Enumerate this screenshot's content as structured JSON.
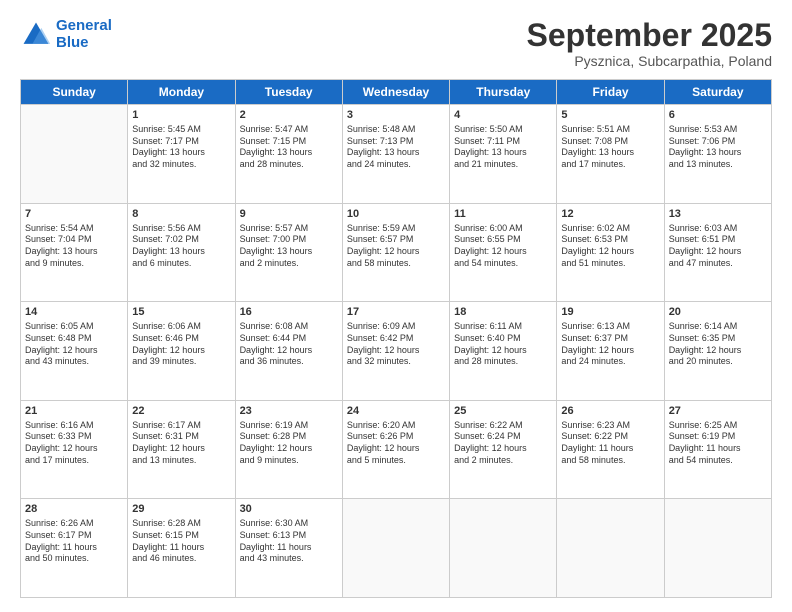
{
  "logo": {
    "line1": "General",
    "line2": "Blue"
  },
  "header": {
    "month": "September 2025",
    "location": "Pysznica, Subcarpathia, Poland"
  },
  "weekdays": [
    "Sunday",
    "Monday",
    "Tuesday",
    "Wednesday",
    "Thursday",
    "Friday",
    "Saturday"
  ],
  "weeks": [
    [
      {
        "day": "",
        "info": ""
      },
      {
        "day": "1",
        "info": "Sunrise: 5:45 AM\nSunset: 7:17 PM\nDaylight: 13 hours\nand 32 minutes."
      },
      {
        "day": "2",
        "info": "Sunrise: 5:47 AM\nSunset: 7:15 PM\nDaylight: 13 hours\nand 28 minutes."
      },
      {
        "day": "3",
        "info": "Sunrise: 5:48 AM\nSunset: 7:13 PM\nDaylight: 13 hours\nand 24 minutes."
      },
      {
        "day": "4",
        "info": "Sunrise: 5:50 AM\nSunset: 7:11 PM\nDaylight: 13 hours\nand 21 minutes."
      },
      {
        "day": "5",
        "info": "Sunrise: 5:51 AM\nSunset: 7:08 PM\nDaylight: 13 hours\nand 17 minutes."
      },
      {
        "day": "6",
        "info": "Sunrise: 5:53 AM\nSunset: 7:06 PM\nDaylight: 13 hours\nand 13 minutes."
      }
    ],
    [
      {
        "day": "7",
        "info": "Sunrise: 5:54 AM\nSunset: 7:04 PM\nDaylight: 13 hours\nand 9 minutes."
      },
      {
        "day": "8",
        "info": "Sunrise: 5:56 AM\nSunset: 7:02 PM\nDaylight: 13 hours\nand 6 minutes."
      },
      {
        "day": "9",
        "info": "Sunrise: 5:57 AM\nSunset: 7:00 PM\nDaylight: 13 hours\nand 2 minutes."
      },
      {
        "day": "10",
        "info": "Sunrise: 5:59 AM\nSunset: 6:57 PM\nDaylight: 12 hours\nand 58 minutes."
      },
      {
        "day": "11",
        "info": "Sunrise: 6:00 AM\nSunset: 6:55 PM\nDaylight: 12 hours\nand 54 minutes."
      },
      {
        "day": "12",
        "info": "Sunrise: 6:02 AM\nSunset: 6:53 PM\nDaylight: 12 hours\nand 51 minutes."
      },
      {
        "day": "13",
        "info": "Sunrise: 6:03 AM\nSunset: 6:51 PM\nDaylight: 12 hours\nand 47 minutes."
      }
    ],
    [
      {
        "day": "14",
        "info": "Sunrise: 6:05 AM\nSunset: 6:48 PM\nDaylight: 12 hours\nand 43 minutes."
      },
      {
        "day": "15",
        "info": "Sunrise: 6:06 AM\nSunset: 6:46 PM\nDaylight: 12 hours\nand 39 minutes."
      },
      {
        "day": "16",
        "info": "Sunrise: 6:08 AM\nSunset: 6:44 PM\nDaylight: 12 hours\nand 36 minutes."
      },
      {
        "day": "17",
        "info": "Sunrise: 6:09 AM\nSunset: 6:42 PM\nDaylight: 12 hours\nand 32 minutes."
      },
      {
        "day": "18",
        "info": "Sunrise: 6:11 AM\nSunset: 6:40 PM\nDaylight: 12 hours\nand 28 minutes."
      },
      {
        "day": "19",
        "info": "Sunrise: 6:13 AM\nSunset: 6:37 PM\nDaylight: 12 hours\nand 24 minutes."
      },
      {
        "day": "20",
        "info": "Sunrise: 6:14 AM\nSunset: 6:35 PM\nDaylight: 12 hours\nand 20 minutes."
      }
    ],
    [
      {
        "day": "21",
        "info": "Sunrise: 6:16 AM\nSunset: 6:33 PM\nDaylight: 12 hours\nand 17 minutes."
      },
      {
        "day": "22",
        "info": "Sunrise: 6:17 AM\nSunset: 6:31 PM\nDaylight: 12 hours\nand 13 minutes."
      },
      {
        "day": "23",
        "info": "Sunrise: 6:19 AM\nSunset: 6:28 PM\nDaylight: 12 hours\nand 9 minutes."
      },
      {
        "day": "24",
        "info": "Sunrise: 6:20 AM\nSunset: 6:26 PM\nDaylight: 12 hours\nand 5 minutes."
      },
      {
        "day": "25",
        "info": "Sunrise: 6:22 AM\nSunset: 6:24 PM\nDaylight: 12 hours\nand 2 minutes."
      },
      {
        "day": "26",
        "info": "Sunrise: 6:23 AM\nSunset: 6:22 PM\nDaylight: 11 hours\nand 58 minutes."
      },
      {
        "day": "27",
        "info": "Sunrise: 6:25 AM\nSunset: 6:19 PM\nDaylight: 11 hours\nand 54 minutes."
      }
    ],
    [
      {
        "day": "28",
        "info": "Sunrise: 6:26 AM\nSunset: 6:17 PM\nDaylight: 11 hours\nand 50 minutes."
      },
      {
        "day": "29",
        "info": "Sunrise: 6:28 AM\nSunset: 6:15 PM\nDaylight: 11 hours\nand 46 minutes."
      },
      {
        "day": "30",
        "info": "Sunrise: 6:30 AM\nSunset: 6:13 PM\nDaylight: 11 hours\nand 43 minutes."
      },
      {
        "day": "",
        "info": ""
      },
      {
        "day": "",
        "info": ""
      },
      {
        "day": "",
        "info": ""
      },
      {
        "day": "",
        "info": ""
      }
    ]
  ]
}
